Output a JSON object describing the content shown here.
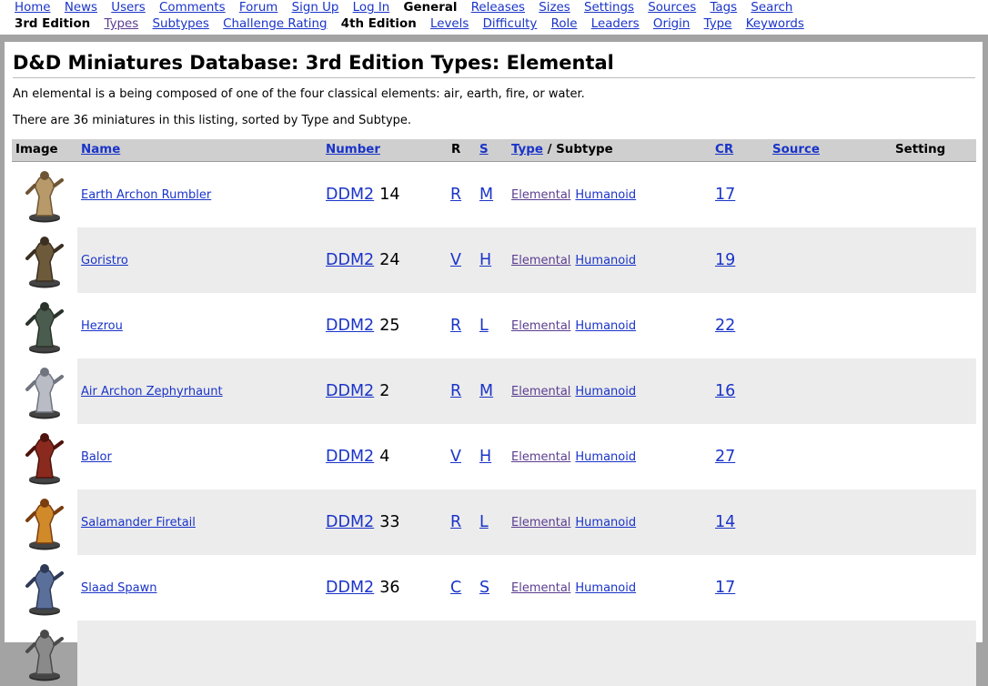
{
  "nav": {
    "row1": [
      "Home",
      "News",
      "Users",
      "Comments",
      "Forum",
      "Sign Up",
      "Log In"
    ],
    "row1_current": "General",
    "row1_after": [
      "Releases",
      "Sizes",
      "Settings",
      "Sources",
      "Tags",
      "Search"
    ],
    "row2_current": "3rd Edition",
    "row2_a": [
      "Types",
      "Subtypes",
      "Challenge Rating"
    ],
    "row2_current2": "4th Edition",
    "row2_b": [
      "Levels",
      "Difficulty",
      "Role",
      "Leaders",
      "Origin",
      "Type",
      "Keywords"
    ]
  },
  "page": {
    "title": "D&D Miniatures Database: 3rd Edition Types: Elemental",
    "description": "An elemental is a being composed of one of the four classical elements: air, earth, fire, or water.",
    "count_text": "There are 36 miniatures in this listing, sorted by Type and Subtype."
  },
  "table": {
    "headers": {
      "image": "Image",
      "name": "Name",
      "number": "Number",
      "r": "R",
      "s": "S",
      "type": "Type",
      "type_sep": " / Subtype",
      "cr": "CR",
      "source": "Source",
      "setting": "Setting"
    },
    "rows": [
      {
        "name": "Earth Archon Rumbler",
        "set": "DDM2",
        "number": "14",
        "rarity": "R",
        "size": "M",
        "type": "Elemental",
        "subtype": "Humanoid",
        "cr": "17",
        "icon": "earth-archon-figure-icon"
      },
      {
        "name": "Goristro",
        "set": "DDM2",
        "number": "24",
        "rarity": "V",
        "size": "H",
        "type": "Elemental",
        "subtype": "Humanoid",
        "cr": "19",
        "icon": "goristro-figure-icon"
      },
      {
        "name": "Hezrou",
        "set": "DDM2",
        "number": "25",
        "rarity": "R",
        "size": "L",
        "type": "Elemental",
        "subtype": "Humanoid",
        "cr": "22",
        "icon": "hezrou-figure-icon"
      },
      {
        "name": "Air Archon Zephyrhaunt",
        "set": "DDM2",
        "number": "2",
        "rarity": "R",
        "size": "M",
        "type": "Elemental",
        "subtype": "Humanoid",
        "cr": "16",
        "icon": "air-archon-figure-icon"
      },
      {
        "name": "Balor",
        "set": "DDM2",
        "number": "4",
        "rarity": "V",
        "size": "H",
        "type": "Elemental",
        "subtype": "Humanoid",
        "cr": "27",
        "icon": "balor-figure-icon"
      },
      {
        "name": "Salamander Firetail",
        "set": "DDM2",
        "number": "33",
        "rarity": "R",
        "size": "L",
        "type": "Elemental",
        "subtype": "Humanoid",
        "cr": "14",
        "icon": "salamander-figure-icon"
      },
      {
        "name": "Slaad Spawn",
        "set": "DDM2",
        "number": "36",
        "rarity": "C",
        "size": "S",
        "type": "Elemental",
        "subtype": "Humanoid",
        "cr": "17",
        "icon": "slaad-figure-icon"
      },
      {
        "name": "",
        "set": "",
        "number": "",
        "rarity": "",
        "size": "",
        "type": "",
        "subtype": "",
        "cr": "",
        "icon": "partial-figure-icon"
      }
    ]
  },
  "colors": {
    "link": "#1a34c8",
    "visited": "#5b3d8f",
    "header_bg": "#cfcfcf",
    "row_alt": "#ececec",
    "frame": "#a3a3a3"
  }
}
